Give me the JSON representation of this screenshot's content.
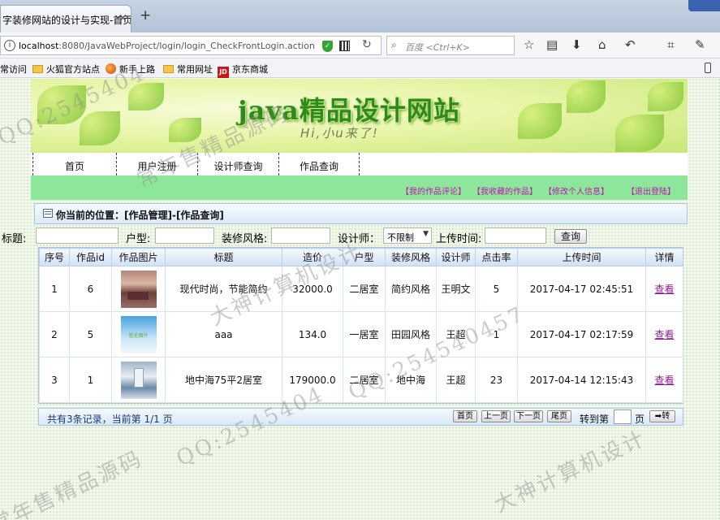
{
  "browser": {
    "tab_title": "字装修网站的设计与实现-首页",
    "tab_close": "×",
    "new_tab": "+",
    "url_host": "localhost",
    "url_path": ":8080/JavaWebProject/login/login_CheckFrontLogin.action",
    "search_placeholder": "百度 <Ctrl+K>",
    "bookmarks": [
      "常访问",
      "火狐官方站点",
      "新手上路",
      "常用网址",
      "京东商城"
    ]
  },
  "site": {
    "title": "java精品设计网站",
    "subtitle": "Hi,小u来了!",
    "menu": [
      "首页",
      "用户注册",
      "设计师查询",
      "作品查询"
    ],
    "user_links": [
      "【我的作品评论】",
      "【我收藏的作品】",
      "【修改个人信息】",
      "【退出登陆】"
    ]
  },
  "location": {
    "text": "你当前的位置：[作品管理]-[作品查询]"
  },
  "search_form": {
    "title_label": "标题:",
    "type_label": "户型:",
    "style_label": "装修风格:",
    "designer_label": "设计师：",
    "designer_value": "不限制",
    "upload_label": "上传时间:",
    "query_button": "查询"
  },
  "table": {
    "headers": [
      "序号",
      "作品id",
      "作品图片",
      "标题",
      "造价",
      "户型",
      "装修风格",
      "设计师",
      "点击率",
      "上传时间",
      "详情"
    ],
    "rows": [
      {
        "no": "1",
        "id": "6",
        "title": "现代时尚，节能简约",
        "price": "32000.0",
        "type": "二居室",
        "style": "简约风格",
        "designer": "王明文",
        "clicks": "5",
        "time": "2017-04-17 02:45:51",
        "detail": "查看"
      },
      {
        "no": "2",
        "id": "5",
        "title": "aaa",
        "price": "134.0",
        "type": "一居室",
        "style": "田园风格",
        "designer": "王超",
        "clicks": "1",
        "time": "2017-04-17 02:17:59",
        "detail": "查看",
        "thumb_text": "暂无图片"
      },
      {
        "no": "3",
        "id": "1",
        "title": "地中海75平2居室",
        "price": "179000.0",
        "type": "二居室",
        "style": "地中海",
        "designer": "王超",
        "clicks": "23",
        "time": "2017-04-14 12:15:43",
        "detail": "查看"
      }
    ]
  },
  "pager": {
    "info": "共有3条记录，当前第 1/1 页",
    "first": "首页",
    "prev": "上一页",
    "next": "下一页",
    "last": "尾页",
    "goto_label": "转到第",
    "page_unit": "页",
    "go_button": "转"
  },
  "watermarks": [
    "QQ:2545404",
    "常年售精品源码",
    "大神计算机设计",
    "QQ:254540457",
    "QQ:2545404",
    "常年售精品源码",
    "大神计算机设计"
  ],
  "colors": {
    "userbar_bg": "#8de79a",
    "user_link": "#c211b4",
    "title_green": "#2f8a1a",
    "view_link": "#8c1d8c"
  }
}
